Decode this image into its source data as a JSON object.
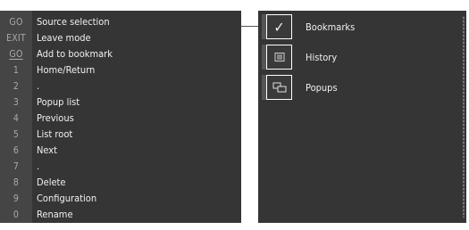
{
  "keys_menu": {
    "rows": [
      {
        "key": "GO",
        "label": "Source selection"
      },
      {
        "key": "EXIT",
        "label": "Leave mode"
      },
      {
        "key": "GO",
        "label": "Add to bookmark",
        "underline": true
      },
      {
        "key": "1",
        "label": "Home/Return"
      },
      {
        "key": "2",
        "label": "."
      },
      {
        "key": "3",
        "label": "Popup list"
      },
      {
        "key": "4",
        "label": "Previous"
      },
      {
        "key": "5",
        "label": "List root"
      },
      {
        "key": "6",
        "label": "Next"
      },
      {
        "key": "7",
        "label": "."
      },
      {
        "key": "8",
        "label": "Delete"
      },
      {
        "key": "9",
        "label": "Configuration"
      },
      {
        "key": "0",
        "label": "Rename"
      }
    ]
  },
  "side_menu": {
    "items": [
      {
        "label": "Bookmarks",
        "icon": "checkmark-icon",
        "selected": true
      },
      {
        "label": "History",
        "icon": "history-icon",
        "selected": false
      },
      {
        "label": "Popups",
        "icon": "popups-icon",
        "selected": false
      }
    ]
  },
  "colors": {
    "panel_bg": "#353535",
    "key_column_bg": "#454545",
    "text": "#f0f0f0",
    "key_text": "#a9a9a9"
  }
}
